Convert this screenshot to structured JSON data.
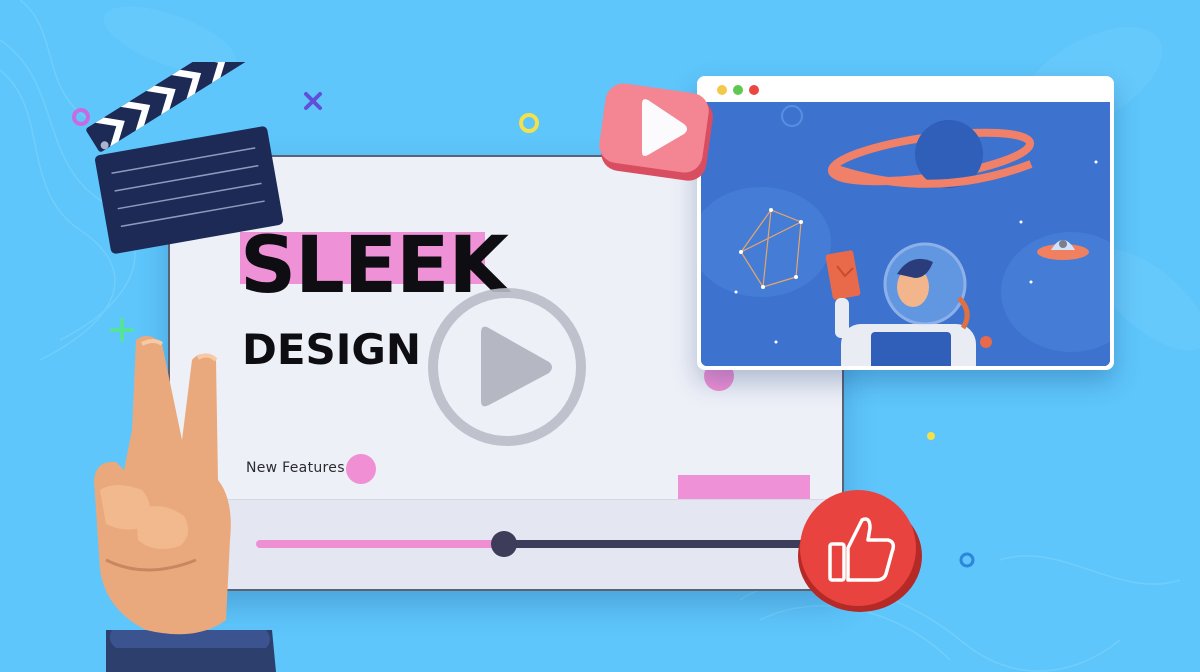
{
  "headline": {
    "line1": "SLEEK",
    "line2": "DESIGN"
  },
  "subtitle": "New Features",
  "video": {
    "progress_fraction": 0.45
  },
  "colors": {
    "background": "#5ec6fb",
    "accent_pink": "#ef91d6",
    "dark_navy": "#3d3c5a",
    "browser_scene": "#3d73cf",
    "like_red": "#e8433e",
    "play_pink": "#f07a87"
  },
  "icons": {
    "clapperboard": "clapperboard-icon",
    "play": "play-icon",
    "like": "thumbs-up-icon",
    "hand": "peace-hand-icon"
  }
}
